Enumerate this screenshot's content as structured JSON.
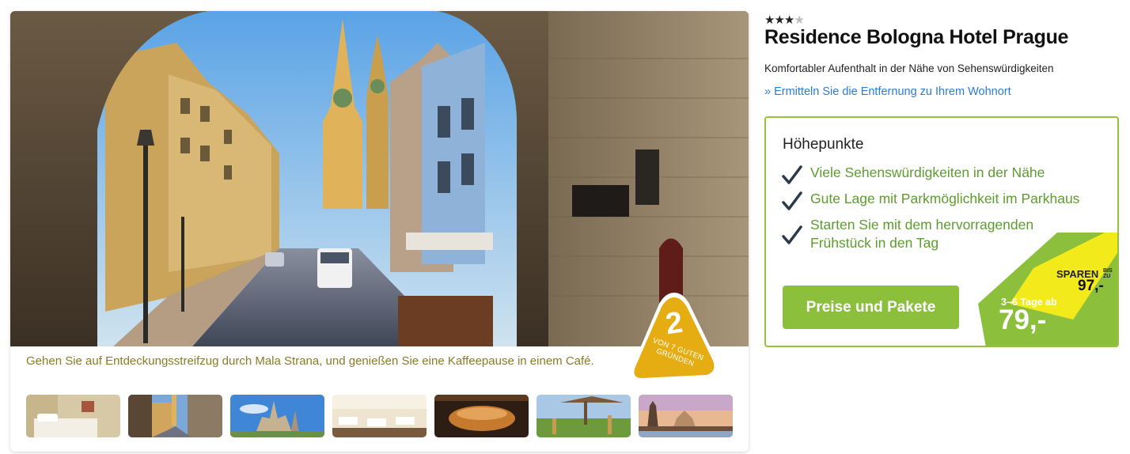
{
  "hotel": {
    "stars": "★★★",
    "half_star": "★",
    "rating_value": 3.5,
    "name": "Residence Bologna Hotel Prague",
    "subtitle": "Komfortabler Aufenthalt in der Nähe von Sehenswürdigkeiten",
    "distance_link": "» Ermitteln Sie die Entfernung zu Ihrem Wohnort"
  },
  "gallery": {
    "caption": "Gehen Sie auf Entdeckungsstreifzug durch Mala Strana, und genießen Sie eine Kaffeepause in einem Café.",
    "badge_number": "2",
    "badge_text_line1": "VON 7 GUTEN",
    "badge_text_line2": "GRÜNDEN",
    "thumbnails": [
      "hotel-room",
      "prague-street",
      "prague-castle",
      "restaurant",
      "brewery",
      "zoo-giraffes",
      "charles-bridge"
    ]
  },
  "highlights": {
    "title": "Höhepunkte",
    "items": [
      "Viele Sehenswürdigkeiten in der Nähe",
      "Gute Lage mit Parkmöglichkeit im Parkhaus",
      "Starten Sie mit dem hervorragenden Frühstück in den Tag"
    ],
    "cta_label": "Preise und Pakete",
    "price_days": "3–6 Tage ab",
    "price_value": "79,-",
    "save_label": "SPAREN",
    "save_upto_1": "BIS",
    "save_upto_2": "ZU",
    "save_value": "97,-"
  },
  "colors": {
    "accent_green": "#8bbf3c",
    "text_green": "#5d9c2e",
    "link_blue": "#2a7bd6",
    "badge_yellow": "#e5ad12",
    "save_yellow": "#f2ea1b",
    "caption_olive": "#8a7a2a"
  },
  "icons": {
    "check": "checkmark-icon",
    "star": "star-icon"
  }
}
